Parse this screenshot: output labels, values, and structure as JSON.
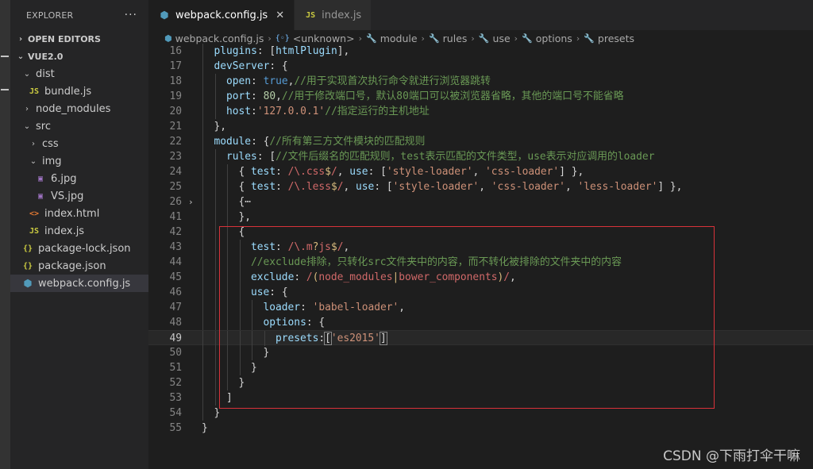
{
  "sidebar": {
    "title": "EXPLORER",
    "more": "···",
    "open_editors": "OPEN EDITORS",
    "project": "VUE2.0",
    "items": [
      {
        "kind": "folder",
        "label": "dist",
        "expanded": true,
        "depth": 1
      },
      {
        "kind": "js",
        "label": "bundle.js",
        "depth": 2,
        "icon": "JS"
      },
      {
        "kind": "folder",
        "label": "node_modules",
        "expanded": false,
        "depth": 1
      },
      {
        "kind": "folder",
        "label": "src",
        "expanded": true,
        "depth": 1
      },
      {
        "kind": "folder",
        "label": "css",
        "expanded": false,
        "depth": 2
      },
      {
        "kind": "folder",
        "label": "img",
        "expanded": true,
        "depth": 2
      },
      {
        "kind": "img",
        "label": "6.jpg",
        "depth": 3,
        "icon": "▣"
      },
      {
        "kind": "img",
        "label": "VS.jpg",
        "depth": 3,
        "icon": "▣"
      },
      {
        "kind": "html",
        "label": "index.html",
        "depth": 2,
        "icon": "<>"
      },
      {
        "kind": "js",
        "label": "index.js",
        "depth": 2,
        "icon": "JS"
      },
      {
        "kind": "json",
        "label": "package-lock.json",
        "depth": 1,
        "icon": "{}"
      },
      {
        "kind": "json",
        "label": "package.json",
        "depth": 1,
        "icon": "{}"
      },
      {
        "kind": "wp",
        "label": "webpack.config.js",
        "depth": 1,
        "icon": "⬢",
        "selected": true
      }
    ]
  },
  "tabs": [
    {
      "label": "webpack.config.js",
      "icon": "⬢",
      "active": true,
      "close": "✕"
    },
    {
      "label": "index.js",
      "icon": "JS",
      "active": false
    }
  ],
  "breadcrumb": [
    "webpack.config.js",
    "<unknown>",
    "module",
    "rules",
    "use",
    "options",
    "presets"
  ],
  "breadcrumb_sep": "›",
  "editor": {
    "current_line": "49",
    "lines": [
      {
        "n": "16",
        "i": 1,
        "t": [
          [
            "key",
            "plugins"
          ],
          [
            "pun",
            ": ["
          ],
          [
            "key",
            "htmlPlugin"
          ],
          [
            "pun",
            "],"
          ]
        ]
      },
      {
        "n": "17",
        "i": 1,
        "t": [
          [
            "key",
            "devServer"
          ],
          [
            "pun",
            ": {"
          ]
        ]
      },
      {
        "n": "18",
        "i": 2,
        "t": [
          [
            "key",
            "open"
          ],
          [
            "pun",
            ": "
          ],
          [
            "bool",
            "true"
          ],
          [
            "pun",
            ","
          ],
          [
            "com",
            "//用于实现首次执行命令就进行浏览器跳转"
          ]
        ]
      },
      {
        "n": "19",
        "i": 2,
        "t": [
          [
            "key",
            "port"
          ],
          [
            "pun",
            ": "
          ],
          [
            "num",
            "80"
          ],
          [
            "pun",
            ","
          ],
          [
            "com",
            "//用于修改端口号，默认80端口可以被浏览器省略，其他的端口号不能省略"
          ]
        ]
      },
      {
        "n": "20",
        "i": 2,
        "t": [
          [
            "key",
            "host"
          ],
          [
            "pun",
            ":"
          ],
          [
            "str",
            "'127.0.0.1'"
          ],
          [
            "com",
            "//指定运行的主机地址"
          ]
        ]
      },
      {
        "n": "21",
        "i": 1,
        "t": [
          [
            "pun",
            "},"
          ]
        ]
      },
      {
        "n": "22",
        "i": 1,
        "t": [
          [
            "key",
            "module"
          ],
          [
            "pun",
            ": {"
          ],
          [
            "com",
            "//所有第三方文件模块的匹配规则"
          ]
        ]
      },
      {
        "n": "23",
        "i": 2,
        "t": [
          [
            "key",
            "rules"
          ],
          [
            "pun",
            ": ["
          ],
          [
            "com",
            "//文件后缀名的匹配规则，test表示匹配的文件类型，use表示对应调用的loader"
          ]
        ]
      },
      {
        "n": "24",
        "i": 3,
        "t": [
          [
            "pun",
            "{ "
          ],
          [
            "key",
            "test"
          ],
          [
            "pun",
            ": "
          ],
          [
            "reg",
            "/\\."
          ],
          [
            "reg",
            "css"
          ],
          [
            "rx",
            "$"
          ],
          [
            "reg",
            "/"
          ],
          [
            "pun",
            ", "
          ],
          [
            "key",
            "use"
          ],
          [
            "pun",
            ": ["
          ],
          [
            "str",
            "'style-loader'"
          ],
          [
            "pun",
            ", "
          ],
          [
            "str",
            "'css-loader'"
          ],
          [
            "pun",
            "] },"
          ]
        ]
      },
      {
        "n": "25",
        "i": 3,
        "t": [
          [
            "pun",
            "{ "
          ],
          [
            "key",
            "test"
          ],
          [
            "pun",
            ": "
          ],
          [
            "reg",
            "/\\."
          ],
          [
            "reg",
            "less"
          ],
          [
            "rx",
            "$"
          ],
          [
            "reg",
            "/"
          ],
          [
            "pun",
            ", "
          ],
          [
            "key",
            "use"
          ],
          [
            "pun",
            ": ["
          ],
          [
            "str",
            "'style-loader'"
          ],
          [
            "pun",
            ", "
          ],
          [
            "str",
            "'css-loader'"
          ],
          [
            "pun",
            ", "
          ],
          [
            "str",
            "'less-loader'"
          ],
          [
            "pun",
            "] },"
          ]
        ]
      },
      {
        "n": "26",
        "i": 3,
        "fold": "›",
        "t": [
          [
            "pun",
            "{⋯"
          ]
        ]
      },
      {
        "n": "41",
        "i": 3,
        "t": [
          [
            "pun",
            "},"
          ]
        ]
      },
      {
        "n": "42",
        "i": 3,
        "t": [
          [
            "pun",
            "{"
          ]
        ]
      },
      {
        "n": "43",
        "i": 4,
        "t": [
          [
            "key",
            "test"
          ],
          [
            "pun",
            ": "
          ],
          [
            "reg",
            "/\\."
          ],
          [
            "reg",
            "m"
          ],
          [
            "rx",
            "?"
          ],
          [
            "reg",
            "js"
          ],
          [
            "rx",
            "$"
          ],
          [
            "reg",
            "/"
          ],
          [
            "pun",
            ","
          ]
        ]
      },
      {
        "n": "44",
        "i": 4,
        "t": [
          [
            "com",
            "//exclude排除，只转化src文件夹中的内容，而不转化被排除的文件夹中的内容"
          ]
        ]
      },
      {
        "n": "45",
        "i": 4,
        "t": [
          [
            "key",
            "exclude"
          ],
          [
            "pun",
            ": "
          ],
          [
            "reg",
            "/"
          ],
          [
            "rx",
            "("
          ],
          [
            "reg",
            "node_modules"
          ],
          [
            "rx",
            "|"
          ],
          [
            "reg",
            "bower_components"
          ],
          [
            "rx",
            ")"
          ],
          [
            "reg",
            "/"
          ],
          [
            "pun",
            ","
          ]
        ]
      },
      {
        "n": "46",
        "i": 4,
        "t": [
          [
            "key",
            "use"
          ],
          [
            "pun",
            ": {"
          ]
        ]
      },
      {
        "n": "47",
        "i": 5,
        "t": [
          [
            "key",
            "loader"
          ],
          [
            "pun",
            ": "
          ],
          [
            "str",
            "'babel-loader'"
          ],
          [
            "pun",
            ","
          ]
        ]
      },
      {
        "n": "48",
        "i": 5,
        "t": [
          [
            "key",
            "options"
          ],
          [
            "pun",
            ": {"
          ]
        ]
      },
      {
        "n": "49",
        "i": 6,
        "t": [
          [
            "key",
            "presets"
          ],
          [
            "pun",
            ":"
          ],
          [
            "br",
            "["
          ],
          [
            "str",
            "'es2015'"
          ],
          [
            "br",
            "]"
          ]
        ]
      },
      {
        "n": "50",
        "i": 5,
        "t": [
          [
            "pun",
            "}"
          ]
        ]
      },
      {
        "n": "51",
        "i": 4,
        "t": [
          [
            "pun",
            "}"
          ]
        ]
      },
      {
        "n": "52",
        "i": 3,
        "t": [
          [
            "pun",
            "}"
          ]
        ]
      },
      {
        "n": "53",
        "i": 2,
        "t": [
          [
            "pun",
            "]"
          ]
        ]
      },
      {
        "n": "54",
        "i": 1,
        "t": [
          [
            "pun",
            "}"
          ]
        ]
      },
      {
        "n": "55",
        "i": 0,
        "t": [
          [
            "pun",
            "}"
          ]
        ]
      }
    ]
  },
  "watermark": "CSDN @下雨打伞干嘛",
  "colors": {
    "highlight_box": "#d9323a",
    "accent": "#519aba"
  }
}
